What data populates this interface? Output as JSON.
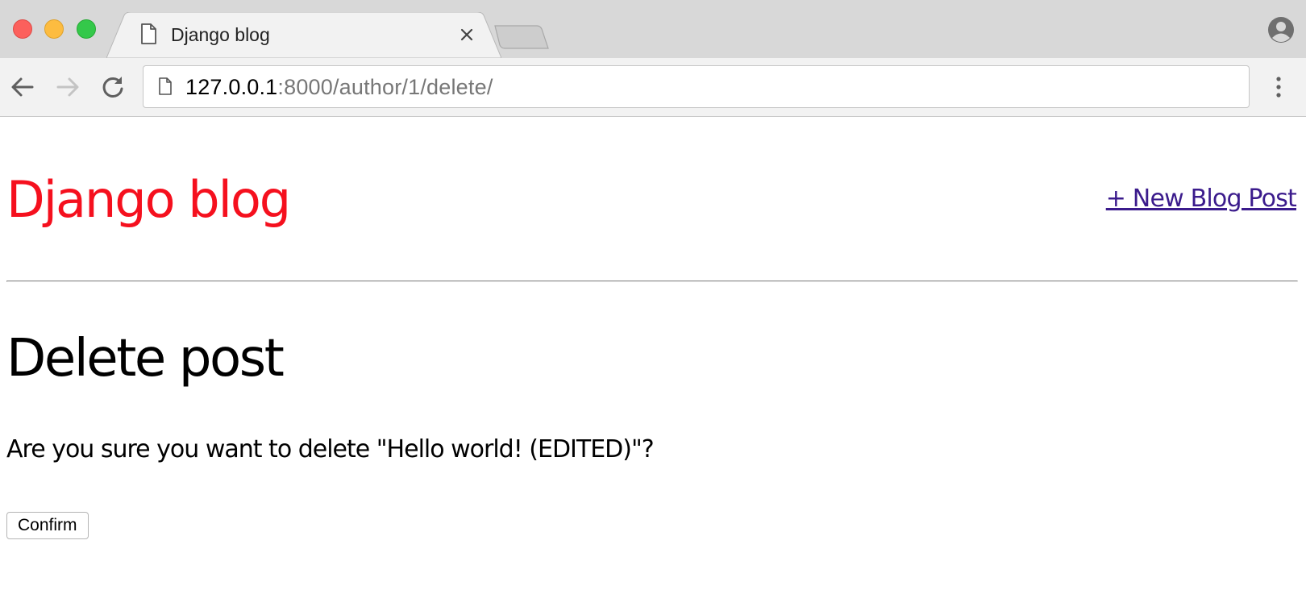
{
  "browser": {
    "tab": {
      "title": "Django blog"
    },
    "address_bar": {
      "host": "127.0.0.1",
      "rest": ":8000/author/1/delete/"
    },
    "icons": {
      "tab_page": "document-icon",
      "tab_close": "close-icon",
      "new_tab": "new-tab-icon",
      "profile": "profile-icon",
      "back": "arrow-left-icon",
      "forward": "arrow-right-icon",
      "reload": "reload-icon",
      "menu": "kebab-menu-icon"
    }
  },
  "site": {
    "title": "Django blog",
    "title_color": "#f5101e",
    "new_post_link": "+ New Blog Post",
    "link_color": "#3b1b8c"
  },
  "content": {
    "heading": "Delete post",
    "question": "Are you sure you want to delete \"Hello world! (EDITED)\"?",
    "confirm_label": "Confirm"
  }
}
